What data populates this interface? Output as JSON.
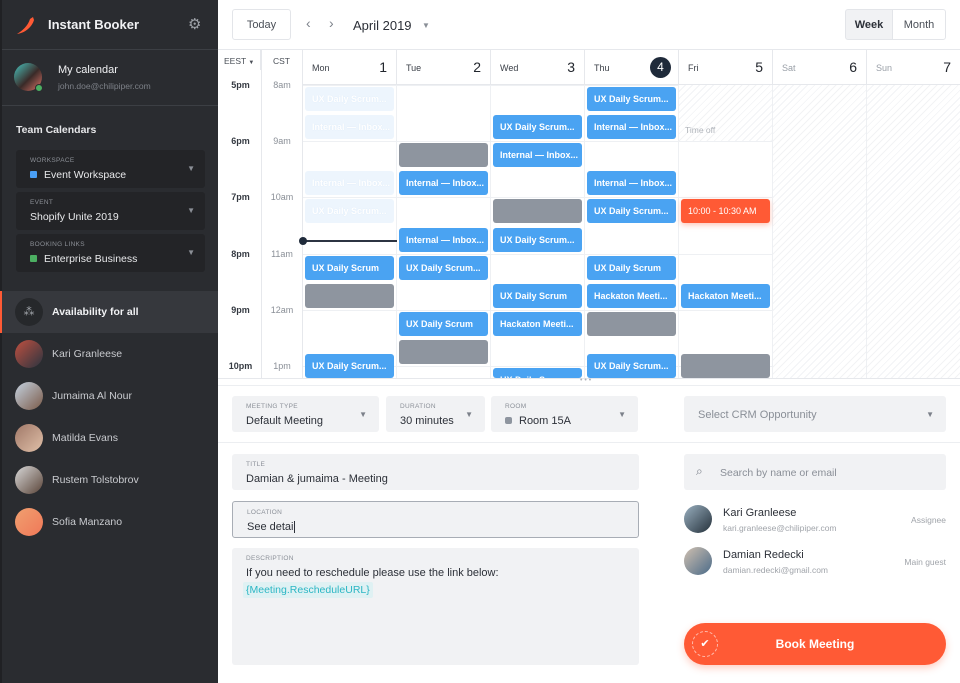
{
  "app": {
    "title": "Instant Booker"
  },
  "my_calendar": {
    "name": "My calendar",
    "email": "john.doe@chilipiper.com"
  },
  "team": {
    "heading": "Team Calendars",
    "workspace": {
      "label": "WORKSPACE",
      "value": "Event Workspace",
      "color": "#4a9ff5"
    },
    "event": {
      "label": "EVENT",
      "value": "Shopify Unite 2019"
    },
    "booking_links": {
      "label": "BOOKING LINKS",
      "value": "Enterprise Business",
      "color": "#4caf62"
    }
  },
  "people": [
    {
      "name": "Availability for all",
      "active": true
    },
    {
      "name": "Kari Granleese"
    },
    {
      "name": "Jumaima Al Nour"
    },
    {
      "name": "Matilda Evans"
    },
    {
      "name": "Rustem Tolstobrov"
    },
    {
      "name": "Sofia Manzano"
    }
  ],
  "toolbar": {
    "today": "Today",
    "month_label": "April 2019",
    "week": "Week",
    "month": "Month",
    "active_view": "Week"
  },
  "timezones": {
    "primary": "EEST",
    "secondary": "CST"
  },
  "hours": [
    {
      "eest": "5pm",
      "cst": "8am"
    },
    {
      "eest": "6pm",
      "cst": "9am"
    },
    {
      "eest": "7pm",
      "cst": "10am"
    },
    {
      "eest": "8pm",
      "cst": "11am"
    },
    {
      "eest": "9pm",
      "cst": "12am"
    },
    {
      "eest": "10pm",
      "cst": "1pm"
    }
  ],
  "days": [
    {
      "name": "Mon",
      "date": "1"
    },
    {
      "name": "Tue",
      "date": "2"
    },
    {
      "name": "Wed",
      "date": "3"
    },
    {
      "name": "Thu",
      "date": "4",
      "today": true
    },
    {
      "name": "Fri",
      "date": "5"
    },
    {
      "name": "Sat",
      "date": "6",
      "weekend": true
    },
    {
      "name": "Sun",
      "date": "7",
      "weekend": true
    }
  ],
  "time_off": {
    "label": "Time off",
    "day": 4,
    "start": 17,
    "end": 18
  },
  "colors": {
    "event": "#4aa3f2",
    "busy": "#8e959f",
    "selected": "#ff5a35",
    "faded": "#edf5fd"
  },
  "events": [
    {
      "day": 0,
      "start": 17,
      "title": "UX Daily Scrum...",
      "kind": "faded"
    },
    {
      "day": 0,
      "start": 17.5,
      "title": "Internal — Inbox...",
      "kind": "faded"
    },
    {
      "day": 0,
      "start": 18.5,
      "title": "Internal — Inbox...",
      "kind": "faded"
    },
    {
      "day": 0,
      "start": 19,
      "title": "UX Daily Scrum...",
      "kind": "faded"
    },
    {
      "day": 0,
      "start": 20,
      "title": "UX Daily Scrum",
      "kind": "event"
    },
    {
      "day": 0,
      "start": 20.5,
      "title": "",
      "kind": "busy"
    },
    {
      "day": 0,
      "start": 21.75,
      "title": "UX Daily Scrum...",
      "kind": "event"
    },
    {
      "day": 1,
      "start": 18,
      "title": "",
      "kind": "busy"
    },
    {
      "day": 1,
      "start": 18.5,
      "title": "Internal — Inbox...",
      "kind": "event"
    },
    {
      "day": 1,
      "start": 19.5,
      "title": "Internal — Inbox...",
      "kind": "event"
    },
    {
      "day": 1,
      "start": 20,
      "title": "UX Daily Scrum...",
      "kind": "event"
    },
    {
      "day": 1,
      "start": 21,
      "title": "UX Daily Scrum",
      "kind": "event"
    },
    {
      "day": 1,
      "start": 21.5,
      "title": "",
      "kind": "busy"
    },
    {
      "day": 2,
      "start": 17.5,
      "title": "UX Daily Scrum...",
      "kind": "event"
    },
    {
      "day": 2,
      "start": 18,
      "title": "Internal — Inbox...",
      "kind": "event"
    },
    {
      "day": 2,
      "start": 19,
      "title": "",
      "kind": "busy"
    },
    {
      "day": 2,
      "start": 19.5,
      "title": "UX Daily Scrum...",
      "kind": "event"
    },
    {
      "day": 2,
      "start": 20.5,
      "title": "UX Daily Scrum",
      "kind": "event"
    },
    {
      "day": 2,
      "start": 21,
      "title": "Hackaton Meeti...",
      "kind": "event"
    },
    {
      "day": 2,
      "start": 22,
      "title": "UX Daily Scrum",
      "kind": "event"
    },
    {
      "day": 3,
      "start": 17,
      "title": "UX Daily Scrum...",
      "kind": "event"
    },
    {
      "day": 3,
      "start": 17.5,
      "title": "Internal — Inbox...",
      "kind": "event"
    },
    {
      "day": 3,
      "start": 18.5,
      "title": "Internal — Inbox...",
      "kind": "event"
    },
    {
      "day": 3,
      "start": 19,
      "title": "UX Daily Scrum...",
      "kind": "event"
    },
    {
      "day": 3,
      "start": 20,
      "title": "UX Daily Scrum",
      "kind": "event"
    },
    {
      "day": 3,
      "start": 20.5,
      "title": "Hackaton Meeti...",
      "kind": "event"
    },
    {
      "day": 3,
      "start": 21,
      "title": "",
      "kind": "busy"
    },
    {
      "day": 3,
      "start": 21.75,
      "title": "UX Daily Scrum...",
      "kind": "event"
    },
    {
      "day": 4,
      "start": 19,
      "title": "10:00 - 10:30 AM",
      "kind": "selected"
    },
    {
      "day": 4,
      "start": 20.5,
      "title": "Hackaton Meeti...",
      "kind": "event"
    },
    {
      "day": 4,
      "start": 21.75,
      "title": "",
      "kind": "busy"
    }
  ],
  "now_line": {
    "day": 0,
    "time": 19.75
  },
  "form": {
    "meeting_type": {
      "label": "MEETING TYPE",
      "value": "Default Meeting"
    },
    "duration": {
      "label": "DURATION",
      "value": "30 minutes"
    },
    "room": {
      "label": "ROOM",
      "value": "Room 15A"
    },
    "crm": {
      "placeholder": "Select CRM Opportunity"
    },
    "title": {
      "label": "TITLE",
      "value": "Damian & jumaima - Meeting"
    },
    "location": {
      "label": "LOCATION",
      "value": "See detai"
    },
    "description": {
      "label": "DESCRIPTION",
      "text": "If you need to reschedule please use the link below:",
      "token": "{Meeting.RescheduleURL}"
    },
    "search": {
      "placeholder": "Search by name or email"
    },
    "attendees": [
      {
        "name": "Kari Granleese",
        "email": "kari.granleese@chilipiper.com",
        "role": "Assignee"
      },
      {
        "name": "Damian Redecki",
        "email": "damian.redecki@gmail.com",
        "role": "Main guest"
      }
    ],
    "book_button": "Book Meeting"
  }
}
